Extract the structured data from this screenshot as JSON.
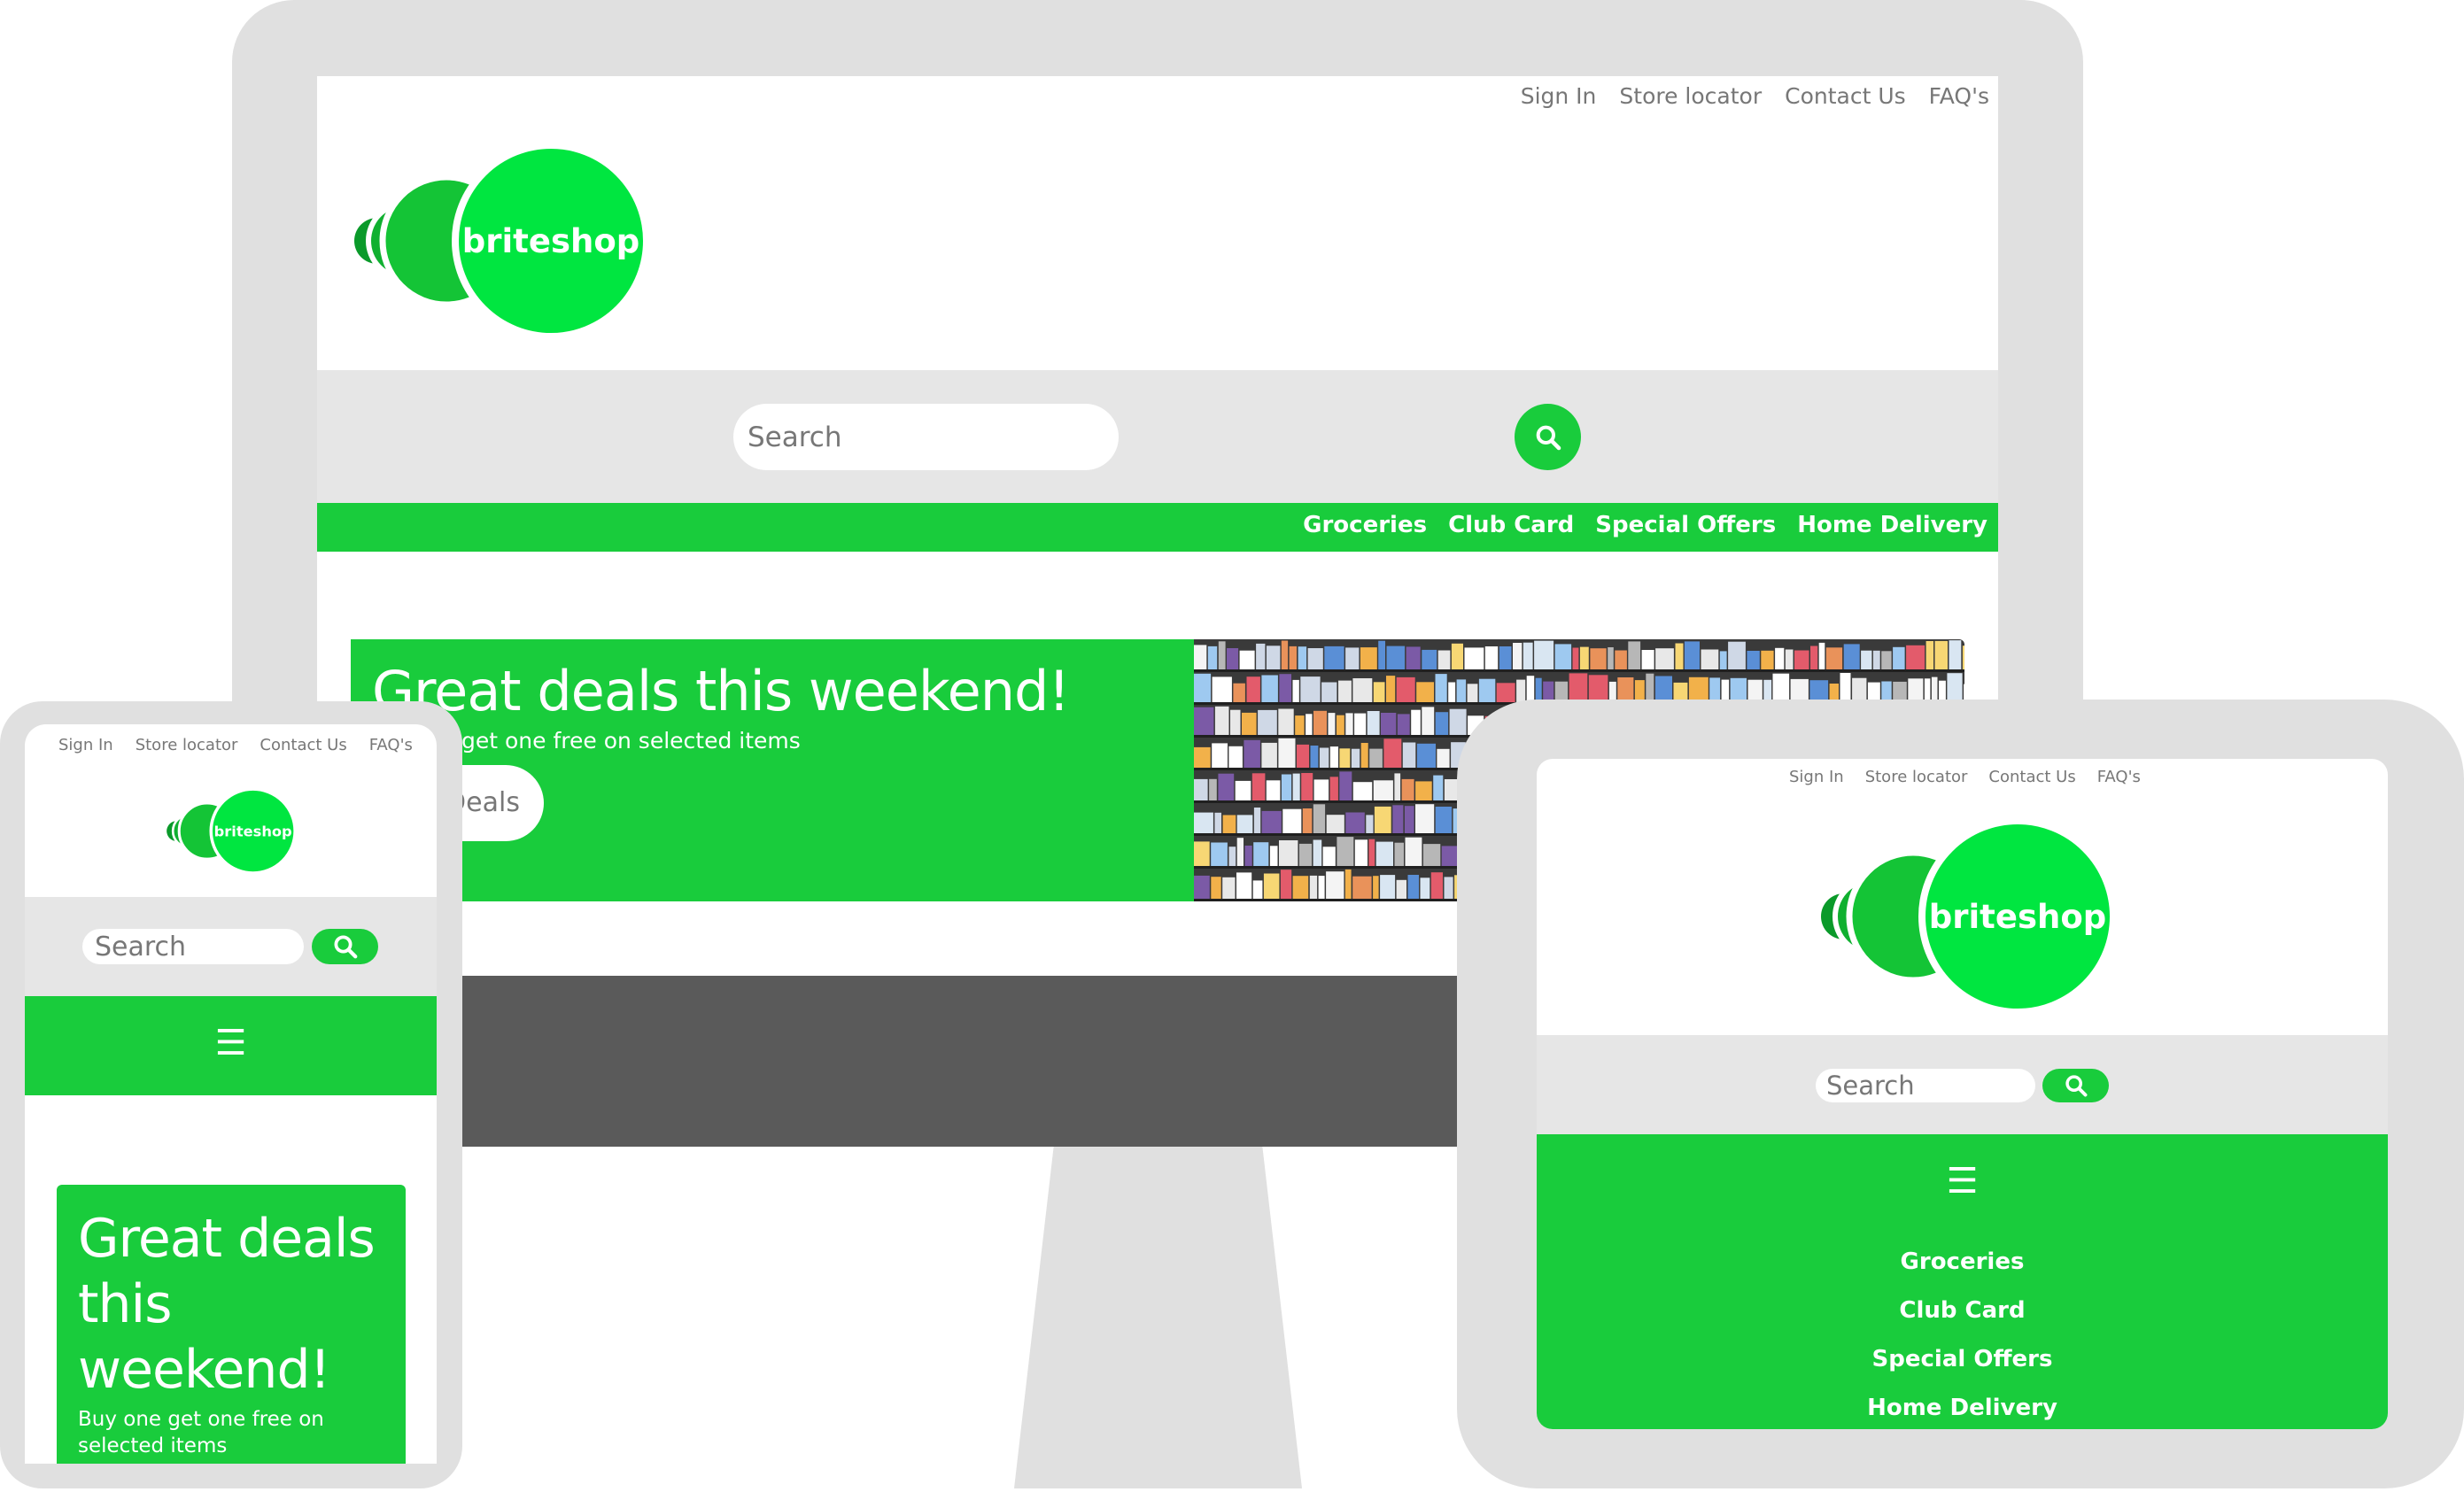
{
  "colors": {
    "brand_green": "#19cc3c",
    "logo_green": "#00e640",
    "logo_dark_green": "#0a9a2a",
    "frame_gray": "#e0e0e0",
    "search_band": "#e6e6e6",
    "dark_band": "#5a5a5a"
  },
  "logo": {
    "text": "briteshop"
  },
  "top_links": [
    "Sign In",
    "Store locator",
    "Contact Us",
    "FAQ's"
  ],
  "search": {
    "placeholder": "Search",
    "icon": "search-icon"
  },
  "nav": [
    "Groceries",
    "Club Card",
    "Special Offers",
    "Home Delivery"
  ],
  "hamburger": {
    "icon": "hamburger-icon",
    "glyph": "☰"
  },
  "hero": {
    "title_monitor": "Great deals this weekend!",
    "subtitle_monitor": "get one free on selected items",
    "button_monitor": "Deals",
    "title_phone": "Great deals this weekend!",
    "subtitle_phone": "Buy one get one free on selected items"
  }
}
